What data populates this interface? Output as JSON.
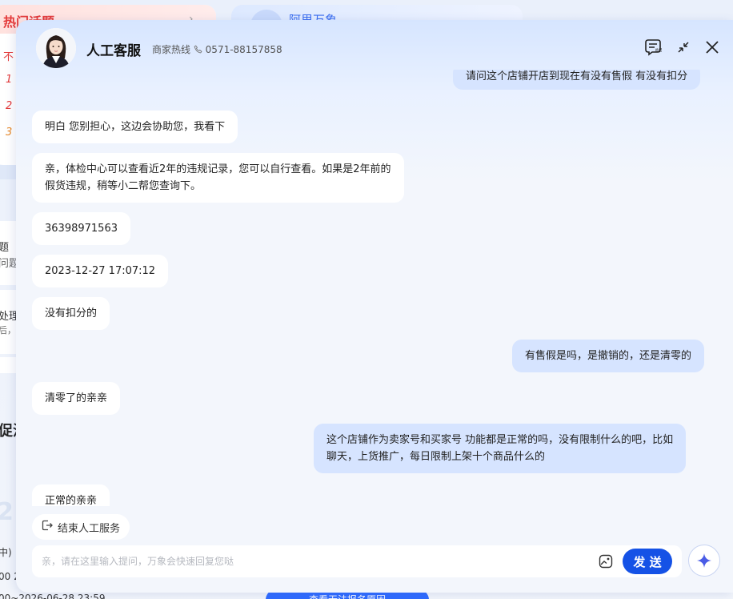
{
  "background": {
    "hot_topics_title": "热门话题",
    "hot_topics_arrow": "›",
    "card2_title": "阿里万象",
    "row_prefix": "不",
    "rank_items": [
      "1",
      "2",
      "3"
    ],
    "side_texts": [
      "题",
      "问题",
      "处理",
      "后，查"
    ],
    "promo_label": "促活",
    "big_number": "2",
    "status_snippet": "中)",
    "time_snippet1": "00 2",
    "time_snippet2": "00~2026-06-28 23:59",
    "bottom_button": "查看无法报名原因"
  },
  "header": {
    "agent_name": "人工客服",
    "hotline_label": "商家热线",
    "hotline_number": "0571-88157858",
    "summary_icon_label": "总结"
  },
  "messages": [
    {
      "role": "user",
      "lines": [
        "请问这个店铺开店到现在有没有售假 有没有扣分"
      ]
    },
    {
      "role": "agent",
      "lines": [
        "明白 您别担心，这边会协助您，我看下"
      ]
    },
    {
      "role": "agent",
      "lines": [
        "亲，体检中心可以查看近2年的违规记录，您可以自行查看。如果是2年前的",
        "假货违规，稍等小二帮您查询下。"
      ]
    },
    {
      "role": "agent",
      "lines": [
        "36398971563"
      ]
    },
    {
      "role": "agent",
      "lines": [
        "2023-12-27 17:07:12"
      ]
    },
    {
      "role": "agent",
      "lines": [
        "没有扣分的"
      ]
    },
    {
      "role": "user",
      "lines": [
        "有售假是吗，是撤销的，还是清零的"
      ]
    },
    {
      "role": "agent",
      "lines": [
        "清零了的亲亲"
      ]
    },
    {
      "role": "user",
      "lines": [
        "这个店铺作为卖家号和买家号 功能都是正常的吗，没有限制什么的吧，比如",
        "聊天，上货推广，每日限制上架十个商品什么的"
      ]
    },
    {
      "role": "agent",
      "lines": [
        "正常的亲亲"
      ]
    }
  ],
  "footer": {
    "end_service_label": "结束人工服务",
    "input_placeholder": "亲，请在这里输入提问，万象会快速回复您哒",
    "input_value": "",
    "send_label": "发 送"
  },
  "colors": {
    "accent": "#1552e6",
    "user_bubble": "#d6e4ff",
    "agent_bubble": "#ffffff",
    "hot_red": "#e43a3a"
  },
  "icons": {
    "summary": "summary-icon",
    "minimize": "minimize-icon",
    "close": "close-icon",
    "end_service": "exit-icon",
    "image_upload": "image-icon",
    "ai_assistant": "sparkle-icon",
    "phone": "phone-icon"
  }
}
